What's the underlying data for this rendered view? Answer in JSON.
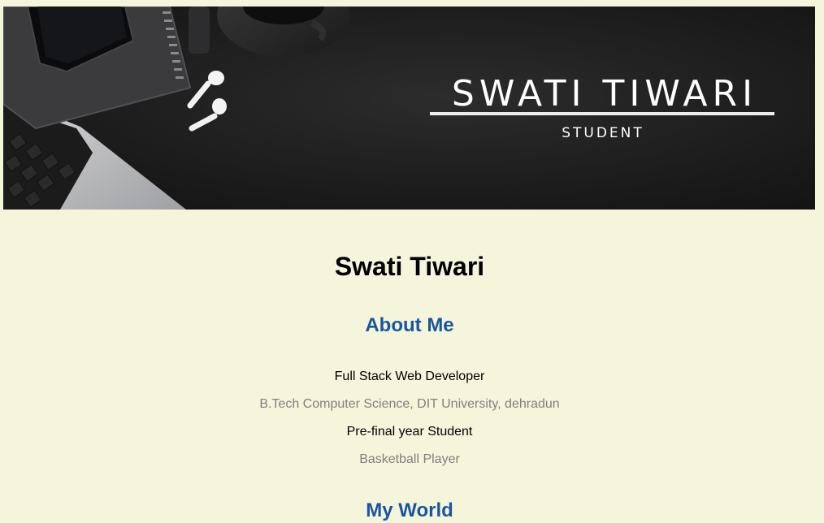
{
  "banner": {
    "name": "SWATI TIWARI",
    "subtitle": "STUDENT"
  },
  "profile": {
    "name": "Swati Tiwari"
  },
  "about": {
    "title": "About Me",
    "lines": [
      "Full Stack Web Developer",
      "B.Tech Computer Science, DIT University, dehradun",
      "Pre-final year Student",
      "Basketball Player"
    ]
  },
  "world": {
    "title": "My World"
  },
  "colors": {
    "page_background": "#f5f5dc",
    "heading_blue": "#1a56a0",
    "muted_text": "#808080",
    "banner_dark": "#1c1c1c"
  }
}
